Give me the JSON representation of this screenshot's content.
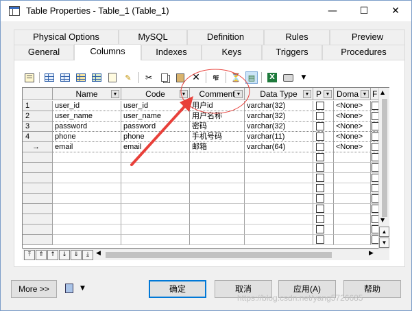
{
  "window": {
    "title": "Table Properties - Table_1 (Table_1)",
    "minimize": "—",
    "maximize": "☐",
    "close": "✕"
  },
  "tabs_row1": [
    {
      "label": "Physical Options"
    },
    {
      "label": "MySQL"
    },
    {
      "label": "Definition"
    },
    {
      "label": "Rules"
    },
    {
      "label": "Preview"
    }
  ],
  "tabs_row2": [
    {
      "label": "General"
    },
    {
      "label": "Columns",
      "active": true
    },
    {
      "label": "Indexes"
    },
    {
      "label": "Keys"
    },
    {
      "label": "Triggers"
    },
    {
      "label": "Procedures"
    }
  ],
  "toolbar": {
    "icons": [
      "properties-icon",
      "insert-row-icon",
      "add-row-icon",
      "add-columns-icon",
      "add-attributes-icon",
      "new-icon",
      "cut-icon",
      "copy-icon",
      "paste-icon",
      "delete-icon",
      "find-icon",
      "filter-icon",
      "customize-columns-icon",
      "excel-export-icon",
      "print-icon",
      "dropdown-arrow-icon"
    ]
  },
  "grid": {
    "columns": [
      "Name",
      "Code",
      "Comment",
      "Data Type",
      "P",
      "Doma",
      "F"
    ],
    "rows": [
      {
        "num": "1",
        "name": "user_id",
        "code": "user_id",
        "comment": "用户id",
        "type": "varchar(32)",
        "domain": "<None>"
      },
      {
        "num": "2",
        "name": "user_name",
        "code": "user_name",
        "comment": "用户名称",
        "type": "varchar(32)",
        "domain": "<None>"
      },
      {
        "num": "3",
        "name": "password",
        "code": "password",
        "comment": "密码",
        "type": "varchar(32)",
        "domain": "<None>"
      },
      {
        "num": "4",
        "name": "phone",
        "code": "phone",
        "comment": "手机号码",
        "type": "varchar(11)",
        "domain": "<None>"
      },
      {
        "num": "→",
        "name": "email",
        "code": "email",
        "comment": "邮箱",
        "type": "varchar(64)",
        "domain": "<None>"
      }
    ],
    "empty_rows": 9
  },
  "buttons": {
    "more": "More >>",
    "ok": "确定",
    "cancel": "取消",
    "apply": "应用(A)",
    "help": "帮助"
  },
  "watermark": "https://blog.csdn.net/yang5726685",
  "colors": {
    "annotation_red": "#e8403a",
    "default_button_border": "#0078d7"
  }
}
